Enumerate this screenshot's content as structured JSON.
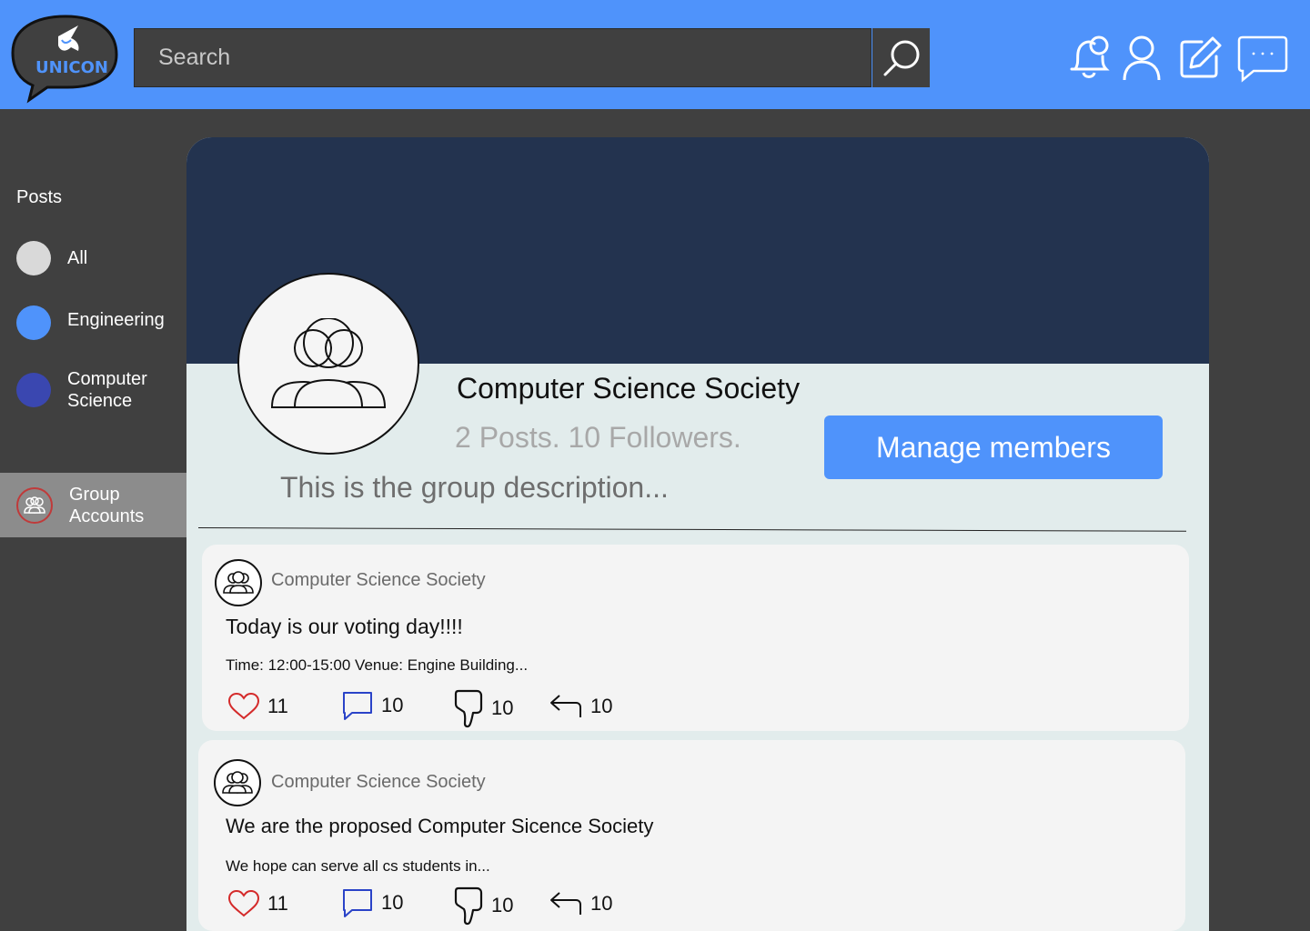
{
  "header": {
    "logo_text": "UNICON",
    "search": {
      "placeholder": "Search",
      "value": ""
    }
  },
  "sidebar": {
    "title": "Posts",
    "items": [
      {
        "label": "All",
        "color": "#d9d9d9"
      },
      {
        "label": "Engineering",
        "color": "#4f93fb"
      },
      {
        "label": "Computer\nScience",
        "color": "#3a47b0"
      }
    ],
    "group_accounts": {
      "label": "Group\nAccounts"
    }
  },
  "group": {
    "name": "Computer Science Society",
    "stats": "2 Posts. 10 Followers.",
    "description": "This is the group description...",
    "manage_label": "Manage members"
  },
  "posts": [
    {
      "author": "Computer Science Society",
      "title": "Today is our voting day!!!!",
      "body": "Time: 12:00-15:00 Venue: Engine Building...",
      "likes": "11",
      "comments": "10",
      "dislikes": "10",
      "shares": "10"
    },
    {
      "author": "Computer Science Society",
      "title": "We are the proposed Computer Sicence Society",
      "body": "We hope can serve all cs students in...",
      "likes": "11",
      "comments": "10",
      "dislikes": "10",
      "shares": "10"
    }
  ],
  "colors": {
    "brand": "#4f93fb",
    "banner": "#23334f",
    "like": "#d42a2a",
    "comment": "#2a43c8"
  }
}
